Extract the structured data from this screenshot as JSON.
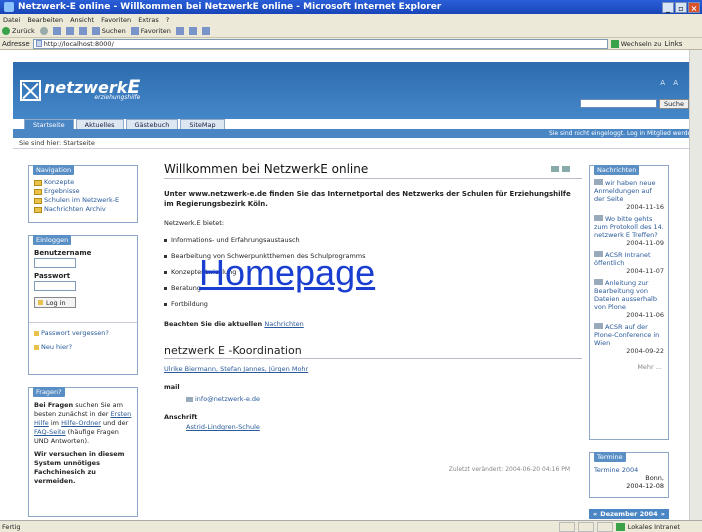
{
  "window": {
    "title": "Netzwerk-E online - Willkommen bei NetzwerkE online - Microsoft Internet Explorer"
  },
  "menu": [
    "Datei",
    "Bearbeiten",
    "Ansicht",
    "Favoriten",
    "Extras",
    "?"
  ],
  "toolbar": {
    "back": "Zurück",
    "search": "Suchen",
    "favorites": "Favoriten"
  },
  "address": {
    "label": "Adresse",
    "url": "http://localhost:8000/",
    "go": "Wechseln zu",
    "links": "Links"
  },
  "site": {
    "logo_main": "netzwerk",
    "logo_e": "E",
    "logo_sub": "erziehungshilfe",
    "font_size_controls": "A A",
    "search_button": "Suche"
  },
  "tabs": [
    "Startseite",
    "Aktuelles",
    "Gästebuch",
    "SiteMap"
  ],
  "userbar": "Sie sind nicht eingeloggt.   Log in   Mitglied werden",
  "breadcrumb": "Sie sind hier: Startseite",
  "navigation": {
    "title": "Navigation",
    "items": [
      "Konzepte",
      "Ergebnisse",
      "Schulen im Netzwerk-E",
      "Nachrichten Archiv"
    ]
  },
  "login": {
    "title": "Einloggen",
    "user_label": "Benutzername",
    "pass_label": "Passwort",
    "button": "Log in",
    "forgot": "Passwort vergessen?",
    "new": "Neu hier?"
  },
  "fragen": {
    "title": "Fragen?",
    "p1_bold": "Bei Fragen",
    "p1_a": " suchen Sie am besten zunächst in der ",
    "p1_link1": "Ersten Hilfe",
    "p1_b": " im ",
    "p1_link2": "Hilfe-Ordner",
    "p1_c": " und der ",
    "p1_link3": "FAQ-Seite",
    "p1_d": " (häufige Fragen UND Antworten).",
    "p2": "Wir versuchen in diesem System unnötiges Fachchinesich zu vermeiden."
  },
  "main": {
    "title": "Willkommen bei NetzwerkE online",
    "lead": "Unter www.netzwerk-e.de finden Sie das Internetportal des Netzwerks der Schulen für Erziehungshilfe im Regierungsbezirk Köln.",
    "offers_label": "Netzwerk.E bietet:",
    "offers": [
      "Informations- und Erfahrungsaustausch",
      "Bearbeitung von Schwerpunktthemen des Schulprogramms",
      "Konzeptentwicklung",
      "Beratung",
      "Fortbildung"
    ],
    "note_bold": "Beachten Sie die aktuellen ",
    "note_link": "Nachrichten",
    "coord_title": "netzwerk E -Koordination",
    "names": "Ulrike Biermann, Stefan Jannes, Jürgen Mohr",
    "mail_label": "mail",
    "mail": "info@netzwerk-e.de",
    "address_label": "Anschrift",
    "school": "Astrid-Lindgren-Schule",
    "updated": "Zuletzt verändert: 2004-06-20 04:16 PM"
  },
  "overlay": "Homepage",
  "news": {
    "title": "Nachrichten",
    "items": [
      {
        "text": "wir haben neue Anmeldungen auf der Seite",
        "date": "2004-11-16"
      },
      {
        "text": "Wo bitte gehts zum Protokoll des 14. netzwerk E Treffen?",
        "date": "2004-11-09"
      },
      {
        "text": "ACSR Intranet öffentlich",
        "date": "2004-11-07"
      },
      {
        "text": "Anleitung zur Bearbeitung von Dateien ausserhalb von Plone",
        "date": "2004-11-06"
      },
      {
        "text": "ACSR auf der Plone-Conference in Wien",
        "date": "2004-09-22"
      }
    ],
    "more": "Mehr ..."
  },
  "termine": {
    "title": "Termine",
    "item": "Termine 2004",
    "place": "Bonn,",
    "date": "2004-12-08"
  },
  "calendar": {
    "prev": "«",
    "month": "Dezember 2004",
    "next": "»"
  },
  "status": {
    "left": "Fertig",
    "zone": "Lokales Intranet"
  }
}
